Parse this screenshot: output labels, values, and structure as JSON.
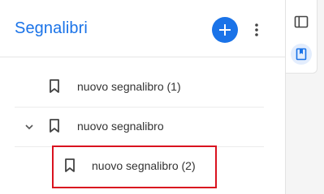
{
  "panel": {
    "title": "Segnalibri",
    "add_icon": "plus-icon",
    "more_icon": "more-vert-icon",
    "accent": "#1a73e8"
  },
  "bookmarks": [
    {
      "label": "nuovo segnalibro (1)",
      "icon": "bookmark-icon"
    },
    {
      "label": "nuovo segnalibro",
      "icon": "bookmark-icon",
      "expanded": true
    },
    {
      "label": "nuovo segnalibro (2)",
      "icon": "bookmark-icon",
      "highlighted": true
    }
  ],
  "rail": {
    "items": [
      {
        "icon": "sidebar-panel-icon",
        "active": false
      },
      {
        "icon": "bookmark-book-icon",
        "active": true
      }
    ]
  },
  "highlight_color": "#d9121f"
}
